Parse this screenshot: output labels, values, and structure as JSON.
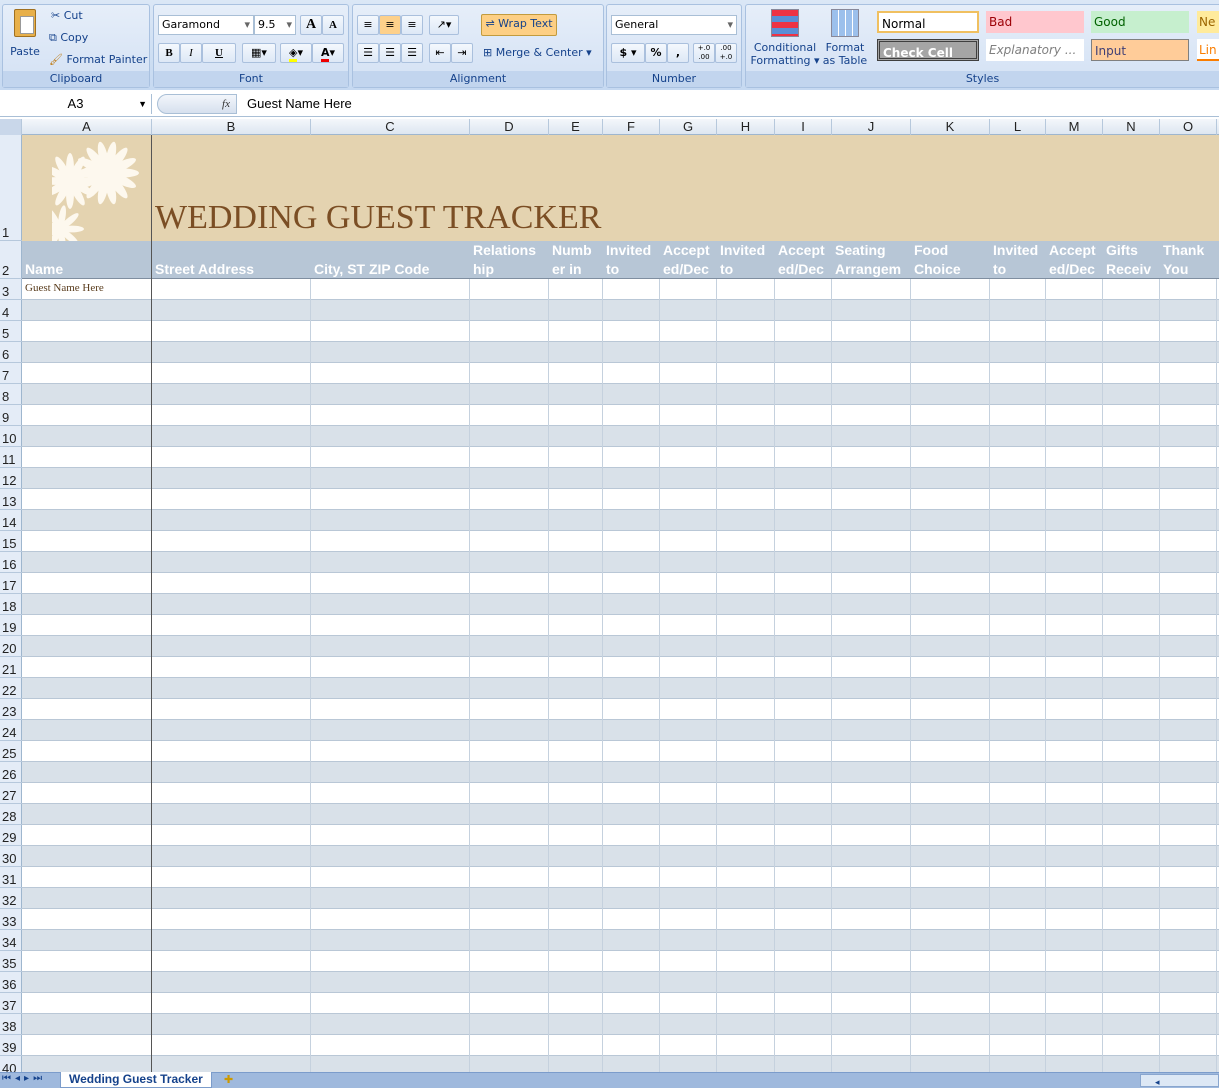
{
  "ribbon": {
    "clipboard": {
      "label": "Clipboard",
      "paste": "Paste",
      "cut": "Cut",
      "copy": "Copy",
      "format_painter": "Format Painter"
    },
    "font": {
      "label": "Font",
      "font_name": "Garamond",
      "font_size": "9.5",
      "bold": "B",
      "italic": "I",
      "underline": "U",
      "grow": "A",
      "shrink": "A",
      "font_color": "A"
    },
    "alignment": {
      "label": "Alignment",
      "wrap_text": "Wrap Text",
      "merge_center": "Merge & Center"
    },
    "number": {
      "label": "Number",
      "format": "General",
      "currency": "$",
      "percent": "%",
      "comma": ",",
      "inc_decimal": "+.0 .00",
      "dec_decimal": ".00 +.0"
    },
    "styles": {
      "label": "Styles",
      "conditional_formatting": "Conditional Formatting",
      "format_as_table": "Format as Table",
      "cells": [
        {
          "name": "Normal",
          "bg": "#ffffff",
          "fg": "#000000"
        },
        {
          "name": "Bad",
          "bg": "#ffc7ce",
          "fg": "#9c0006"
        },
        {
          "name": "Good",
          "bg": "#c6efce",
          "fg": "#006100"
        },
        {
          "name": "Ne",
          "bg": "#ffeb9c",
          "fg": "#9c6500"
        },
        {
          "name": "Check Cell",
          "bg": "#a5a5a5",
          "fg": "#ffffff"
        },
        {
          "name": "Explanatory ...",
          "bg": "#ffffff",
          "fg": "#7f7f7f"
        },
        {
          "name": "Input",
          "bg": "#ffcc99",
          "fg": "#3f3f76"
        },
        {
          "name": "Lin",
          "bg": "#ffffff",
          "fg": "#fa7d00"
        }
      ]
    }
  },
  "formula_bar": {
    "name_box": "A3",
    "fx": "fx",
    "value": "Guest Name Here"
  },
  "columns": [
    "A",
    "B",
    "C",
    "D",
    "E",
    "F",
    "G",
    "H",
    "I",
    "J",
    "K",
    "L",
    "M",
    "N",
    "O"
  ],
  "sheet": {
    "title": "WEDDING GUEST TRACKER",
    "headers": [
      {
        "lines": [
          "",
          "Name"
        ]
      },
      {
        "lines": [
          "",
          "Street Address"
        ]
      },
      {
        "lines": [
          "",
          "City, ST  ZIP Code"
        ]
      },
      {
        "lines": [
          "Relations",
          "hip"
        ]
      },
      {
        "lines": [
          "Numb",
          "er in"
        ]
      },
      {
        "lines": [
          "Invited",
          "to"
        ]
      },
      {
        "lines": [
          "Accept",
          "ed/Dec"
        ]
      },
      {
        "lines": [
          "Invited",
          "to"
        ]
      },
      {
        "lines": [
          "Accept",
          "ed/Dec"
        ]
      },
      {
        "lines": [
          "Seating",
          "Arrangem"
        ]
      },
      {
        "lines": [
          "Food",
          "Choice"
        ]
      },
      {
        "lines": [
          "Invited",
          "to"
        ]
      },
      {
        "lines": [
          "Accept",
          "ed/Dec"
        ]
      },
      {
        "lines": [
          "Gifts",
          "Receiv"
        ]
      },
      {
        "lines": [
          "Thank",
          "You"
        ]
      }
    ],
    "first_row_value": "Guest Name Here",
    "row_numbers": [
      1,
      2,
      3,
      4,
      5,
      6,
      7,
      8,
      9,
      10,
      11,
      12,
      13,
      14,
      15,
      16,
      17,
      18,
      19,
      20,
      21,
      22,
      23,
      24,
      25,
      26,
      27,
      28,
      29,
      30,
      31,
      32,
      33,
      34,
      35,
      36,
      37,
      38,
      39,
      40
    ],
    "colors": {
      "banner": "#e4d3b0",
      "header": "#b7c6d6",
      "band": "#d9e1e9",
      "title": "#7b4e24"
    }
  },
  "tabs": {
    "active": "Wedding Guest Tracker"
  }
}
